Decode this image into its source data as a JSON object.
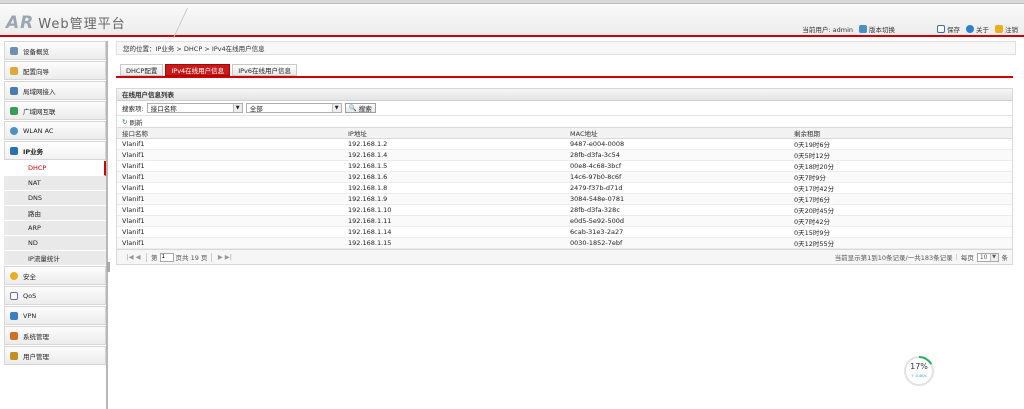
{
  "header": {
    "logo_ar": "AR",
    "logo_title": "Web管理平台",
    "current_user_label": "当前用户: admin",
    "version_switch": "版本切换",
    "save": "保存",
    "about": "关于",
    "logout": "注销"
  },
  "sidebar": {
    "items": [
      {
        "label": "设备概览",
        "icon": "monitor-icon",
        "color": "#6b8fb5"
      },
      {
        "label": "配置向导",
        "icon": "folder-icon",
        "color": "#e0a73a"
      },
      {
        "label": "局域网接入",
        "icon": "lan-icon",
        "color": "#4a7bb0"
      },
      {
        "label": "广域网互联",
        "icon": "wan-icon",
        "color": "#3a9a5a"
      },
      {
        "label": "WLAN AC",
        "icon": "wifi-icon",
        "color": "#4a90c0"
      },
      {
        "label": "IP业务",
        "icon": "ip-service-icon",
        "color": "#2d6fb3"
      }
    ],
    "sub_items": [
      {
        "label": "DHCP",
        "active": true
      },
      {
        "label": "NAT",
        "active": false
      },
      {
        "label": "DNS",
        "active": false
      },
      {
        "label": "路由",
        "active": false
      },
      {
        "label": "ARP",
        "active": false
      },
      {
        "label": "ND",
        "active": false
      },
      {
        "label": "IP流量统计",
        "active": false
      }
    ],
    "items_after": [
      {
        "label": "安全",
        "icon": "shield-icon",
        "color": "#e8b020"
      },
      {
        "label": "QoS",
        "icon": "qos-icon",
        "color": "#7a5fb0"
      },
      {
        "label": "VPN",
        "icon": "vpn-icon",
        "color": "#3a7fc0"
      },
      {
        "label": "系统管理",
        "icon": "system-icon",
        "color": "#d07020"
      },
      {
        "label": "用户管理",
        "icon": "user-icon",
        "color": "#c09020"
      }
    ]
  },
  "breadcrumb": "您的位置：IP业务 > DHCP > IPv4在线用户信息",
  "tabs": [
    {
      "label": "DHCP配置",
      "active": false
    },
    {
      "label": "IPv4在线用户信息",
      "active": true
    },
    {
      "label": "IPv6在线用户信息",
      "active": false
    }
  ],
  "panel": {
    "title": "在线用户信息列表",
    "search_label": "搜索项:",
    "search_field": "接口名称",
    "search_value": "全部",
    "search_button": "搜索",
    "refresh": "刷新"
  },
  "table": {
    "headers": [
      "接口名称",
      "IP地址",
      "MAC地址",
      "剩余租期"
    ],
    "rows": [
      [
        "Vlanif1",
        "192.168.1.2",
        "9487-e004-0008",
        "0天19时6分"
      ],
      [
        "Vlanif1",
        "192.168.1.4",
        "28fb-d3fa-3c54",
        "0天5时12分"
      ],
      [
        "Vlanif1",
        "192.168.1.5",
        "00e8-4c68-3bcf",
        "0天18时20分"
      ],
      [
        "Vlanif1",
        "192.168.1.6",
        "14c6-97b0-8c6f",
        "0天7时9分"
      ],
      [
        "Vlanif1",
        "192.168.1.8",
        "2479-f37b-d71d",
        "0天17时42分"
      ],
      [
        "Vlanif1",
        "192.168.1.9",
        "3084-548e-0781",
        "0天17时6分"
      ],
      [
        "Vlanif1",
        "192.168.1.10",
        "28fb-d3fa-328c",
        "0天20时45分"
      ],
      [
        "Vlanif1",
        "192.168.1.11",
        "e0d5-5e92-500d",
        "0天7时42分"
      ],
      [
        "Vlanif1",
        "192.168.1.14",
        "6cab-31e3-2a27",
        "0天15时9分"
      ],
      [
        "Vlanif1",
        "192.168.1.15",
        "0030-1852-7ebf",
        "0天12时55分"
      ]
    ]
  },
  "pager": {
    "page_prefix": "第",
    "page_value": "1",
    "page_suffix": "页共 19 页",
    "summary": "当前显示第1到10条记录/一共183条记录",
    "per_page_label": "每页",
    "per_page_value": "10",
    "per_page_unit": "条"
  },
  "widget": {
    "percent": "17%",
    "rate": "↑ 0.4K/s",
    "level": 0.17
  }
}
